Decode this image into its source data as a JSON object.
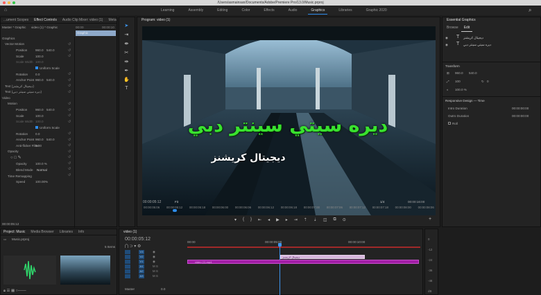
{
  "window": {
    "title": "/Users/asmainsan/Documents/Adobe/Premiere Pro/13.0/Music.prproj",
    "colors": {
      "close": "#fc615d",
      "minimize": "#fdbc40",
      "zoom": "#34c84a"
    }
  },
  "workspaces": {
    "tabs": [
      "Learning",
      "Assembly",
      "Editing",
      "Color",
      "Effects",
      "Audio",
      "Graphics",
      "Libraries",
      "Graphic 2020"
    ],
    "active": "Graphics"
  },
  "left_panel": {
    "tabs": [
      "...ument Scopes",
      "Effect Controls",
      "Audio Clip Mixer: video (1)",
      "Metadata"
    ],
    "active_tab": "Effect Controls",
    "source": "Master * Graphic",
    "clip": "video (1) * Graphic",
    "ruler_start": "00:00",
    "ruler_end": "00:00:10",
    "clip_bar_label": "Graphic",
    "section_graphics": "Graphics",
    "vector_motion": "Vector Motion",
    "position_label": "Position",
    "position_x": "960.0",
    "position_y": "540.0",
    "scale_label": "Scale",
    "scale_value": "100.0",
    "scale_width_label": "Scale Width",
    "scale_width_value": "100.0",
    "uniform_scale": "Uniform Scale",
    "rotation_label": "Rotation",
    "rotation_value": "0.0",
    "anchor_label": "Anchor Point",
    "anchor_x": "960.0",
    "anchor_y": "540.0",
    "text_layer_1": "Text (ديجيتال كريشنز)",
    "text_layer_2": "Text (ديره سيتي سينتر دبي)",
    "section_video": "Video",
    "motion": "Motion",
    "m_position_x": "960.0",
    "m_position_y": "540.0",
    "m_scale": "100.0",
    "m_scale_width": "100.0",
    "m_rotation": "0.0",
    "m_anchor_x": "960.0",
    "m_anchor_y": "540.0",
    "anti_flicker_label": "Anti-flicker Filter",
    "anti_flicker_value": "0.00",
    "opacity_section": "Opacity",
    "opacity_label": "Opacity",
    "opacity_value": "100.0 %",
    "blend_label": "Blend Mode",
    "blend_value": "Normal",
    "time_remap": "Time Remapping",
    "speed_label": "Speed",
    "speed_value": "100.00%",
    "timecode": "00:00:05:12"
  },
  "program": {
    "title": "Program: video (1)",
    "headline": "ديره سيتي سينتر دبي",
    "subtitle": "ديجيتال كريشنز",
    "timecode": "00:00:05:12",
    "fit": "Fit",
    "fraction": "1/4",
    "duration": "00:00:16:00",
    "ruler_ticks": [
      "00:00:05:06",
      "00:00:05:12",
      "00:00:05:18",
      "00:00:06:00",
      "00:00:06:06",
      "00:00:06:12",
      "00:00:06:18",
      "00:00:07:00",
      "00:00:07:06",
      "00:00:07:12",
      "00:00:07:18",
      "00:00:08:00",
      "00:00:08:06"
    ]
  },
  "essential_graphics": {
    "title": "Essential Graphics",
    "tabs": [
      "Browse",
      "Edit"
    ],
    "active_tab": "Edit",
    "layer_1": "ديجيتال كريشنز",
    "layer_2": "ديره سيتي سينتر دبي",
    "transform": "Transform",
    "pos_x": "960.0",
    "pos_y": "540.0",
    "scale": "100",
    "rotation": "0",
    "opacity": "100.0 %",
    "responsive": "Responsive Design — Time",
    "intro_label": "Intro Duration",
    "intro_value": "00:00:00:00",
    "outro_label": "Outro Duration",
    "outro_value": "00:00:00:00",
    "roll": "Roll"
  },
  "project": {
    "tabs": [
      "Project: Music",
      "Media Browser",
      "Libraries",
      "Info"
    ],
    "active_tab": "Project: Music",
    "file": "Music.prproj",
    "items": "5 Items"
  },
  "timeline": {
    "title": "video (1)",
    "timecode": "00:00:05:12",
    "marks": [
      "00:00",
      "00:00:05:00",
      "00:00:10:00"
    ],
    "tracks": [
      "V3",
      "V2",
      "V1",
      "A1",
      "A2",
      "A3"
    ],
    "master": "Master",
    "master_value": "0.0",
    "clip_label": "video (1).mp4",
    "graphic_label": "ديجيتال كريشنز"
  },
  "meter": {
    "labels": [
      "0",
      "-12",
      "-24",
      "-36",
      "-48",
      "dB"
    ]
  },
  "tools": {
    "icons": [
      "selection-icon",
      "track-select-icon",
      "ripple-edit-icon",
      "razor-icon",
      "slip-icon",
      "pen-icon",
      "hand-icon",
      "type-icon"
    ]
  }
}
